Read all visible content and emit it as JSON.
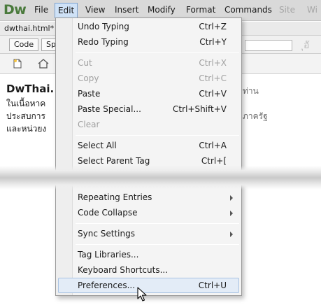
{
  "menubar": {
    "logo": "Dw",
    "items": [
      {
        "label": "File",
        "state": "normal"
      },
      {
        "label": "Edit",
        "state": "active"
      },
      {
        "label": "View",
        "state": "normal"
      },
      {
        "label": "Insert",
        "state": "normal"
      },
      {
        "label": "Modify",
        "state": "normal"
      },
      {
        "label": "Format",
        "state": "normal"
      },
      {
        "label": "Commands",
        "state": "normal"
      },
      {
        "label": "Site",
        "state": "dim"
      },
      {
        "label": "Wi",
        "state": "dim"
      }
    ]
  },
  "document": {
    "tab_label": "dwthai.html*",
    "view_buttons": [
      "Code",
      "Sp"
    ],
    "content_left": [
      "DwThai.",
      "ในเนื้อหาค",
      "ประสบการ",
      "และหน่วยง"
    ],
    "content_right": [
      "ท่าน",
      "ภาครัฐ"
    ]
  },
  "edit_menu": {
    "items": [
      {
        "label": "Undo Typing",
        "shortcut": "Ctrl+Z",
        "enabled": true
      },
      {
        "label": "Redo Typing",
        "shortcut": "Ctrl+Y",
        "enabled": true
      },
      {
        "label": "Cut",
        "shortcut": "Ctrl+X",
        "enabled": false
      },
      {
        "label": "Copy",
        "shortcut": "Ctrl+C",
        "enabled": false
      },
      {
        "label": "Paste",
        "shortcut": "Ctrl+V",
        "enabled": true
      },
      {
        "label": "Paste Special...",
        "shortcut": "Ctrl+Shift+V",
        "enabled": true
      },
      {
        "label": "Clear",
        "shortcut": "",
        "enabled": false
      },
      {
        "label": "Select All",
        "shortcut": "Ctrl+A",
        "enabled": true
      },
      {
        "label": "Select Parent Tag",
        "shortcut": "Ctrl+[",
        "enabled": true
      },
      {
        "label": "Repeating Entries",
        "shortcut": "",
        "enabled": true,
        "submenu": true
      },
      {
        "label": "Code Collapse",
        "shortcut": "",
        "enabled": true,
        "submenu": true
      },
      {
        "label": "Sync Settings",
        "shortcut": "",
        "enabled": true,
        "submenu": true
      },
      {
        "label": "Tag Libraries...",
        "shortcut": "",
        "enabled": true
      },
      {
        "label": "Keyboard Shortcuts...",
        "shortcut": "",
        "enabled": true
      },
      {
        "label": "Preferences...",
        "shortcut": "Ctrl+U",
        "enabled": true,
        "highlighted": true
      }
    ]
  },
  "icons": {
    "new_document": "new-document-icon",
    "home": "home-icon",
    "cursor": "arrow-cursor-icon",
    "submenu": "submenu-arrow-icon"
  },
  "colors": {
    "menubar_bg": "#d9d9d9",
    "active_menu_bg": "#cfe2f7",
    "highlight_bg": "#e3ecf7",
    "logo": "#4a7a3c",
    "disabled_text": "#a0a0a0"
  }
}
